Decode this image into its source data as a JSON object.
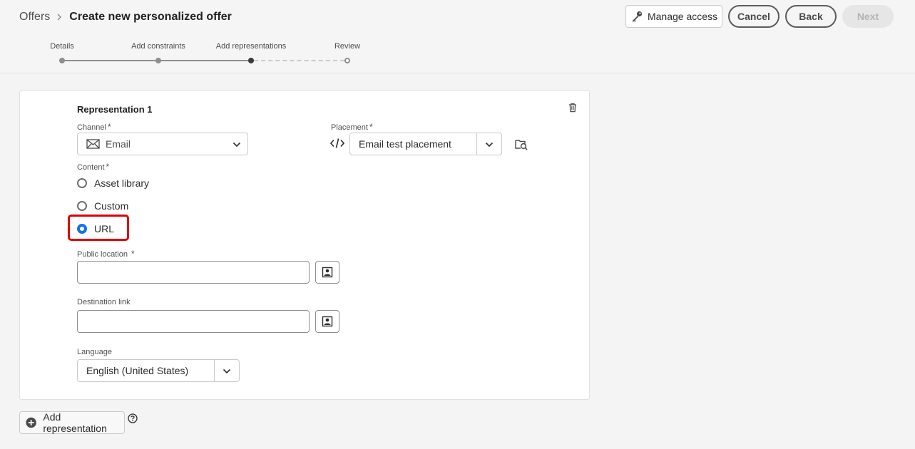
{
  "breadcrumb": {
    "parent": "Offers",
    "title": "Create new personalized offer"
  },
  "actions": {
    "manage_access": "Manage access",
    "cancel": "Cancel",
    "back": "Back",
    "next": "Next"
  },
  "steps": [
    {
      "label": "Details",
      "state": "done"
    },
    {
      "label": "Add constraints",
      "state": "done"
    },
    {
      "label": "Add representations",
      "state": "current"
    },
    {
      "label": "Review",
      "state": "future"
    }
  ],
  "representation": {
    "title": "Representation 1",
    "channel_label": "Channel",
    "channel_value": "Email",
    "placement_label": "Placement",
    "placement_value": "Email test placement",
    "content_label": "Content",
    "content_options": [
      "Asset library",
      "Custom",
      "URL"
    ],
    "content_selected": "URL",
    "public_location_label": "Public location",
    "public_location_value": "",
    "destination_link_label": "Destination link",
    "destination_link_value": "",
    "language_label": "Language",
    "language_value": "English (United States)",
    "required_mark": "*"
  },
  "footer": {
    "add_representation": "Add representation"
  },
  "colors": {
    "accent": "#1473e6",
    "highlight": "#e00000"
  },
  "icons": [
    "chevron-right-icon",
    "key-icon",
    "email-icon",
    "code-icon",
    "placement-browse-icon",
    "trash-icon",
    "chevron-down-icon",
    "image-picker-icon",
    "add-circle-icon",
    "help-icon"
  ]
}
